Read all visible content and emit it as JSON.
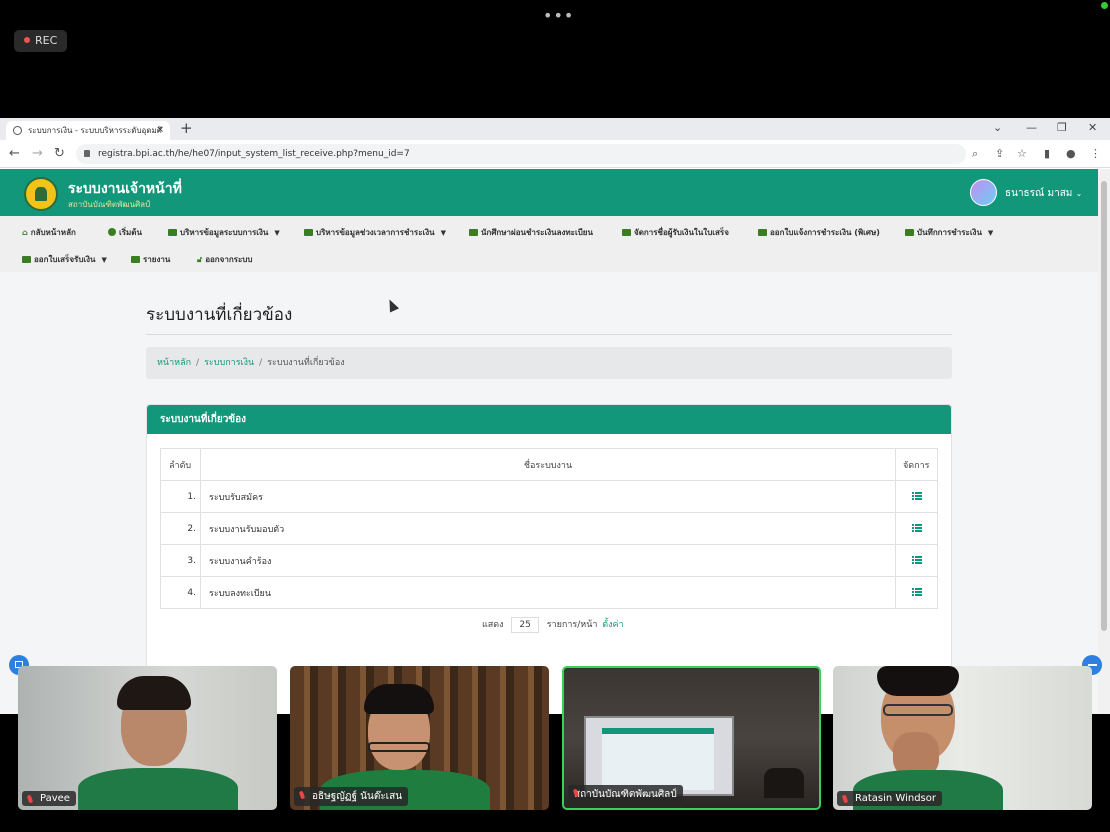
{
  "overlay": {
    "rec_label": "REC",
    "more_dots": "•••"
  },
  "browser": {
    "tab_title": "ระบบการเงิน - ระบบบริหารระดับอุดมศึ",
    "close_tab": "×",
    "new_tab": "+",
    "url": "registra.bpi.ac.th/he/he07/input_system_list_receive.php?menu_id=7"
  },
  "header": {
    "brand_title": "ระบบงานเจ้าหน้าที่",
    "brand_subtitle": "สถาบันบัณฑิตพัฒนศิลป์",
    "user_name": "ธนาธรณ์ มาสม"
  },
  "menu": {
    "items": [
      "กลับหน้าหลัก",
      "เริ่มต้น",
      "บริหารข้อมูลระบบการเงิน",
      "บริหารข้อมูลช่วงเวลาการชำระเงิน",
      "นักศึกษาผ่อนชำระเงินลงทะเบียน",
      "จัดการชื่อผู้รับเงินในใบเสร็จ",
      "ออกใบแจ้งการชำระเงิน (พิเศษ)",
      "บันทึกการชำระเงิน",
      "ออกใบเสร็จรับเงิน",
      "รายงาน",
      "ออกจากระบบ"
    ]
  },
  "main": {
    "page_title": "ระบบงานที่เกี่ยวข้อง",
    "breadcrumb": [
      "หน้าหลัก",
      "ระบบการเงิน",
      "ระบบงานที่เกี่ยวข้อง"
    ],
    "card_title": "ระบบงานที่เกี่ยวข้อง",
    "table": {
      "headers": [
        "ลำดับ",
        "ชื่อระบบงาน",
        "จัดการ"
      ],
      "rows": [
        {
          "no": "1.",
          "name": "ระบบรับสมัคร"
        },
        {
          "no": "2.",
          "name": "ระบบงานรับมอบตัว"
        },
        {
          "no": "3.",
          "name": "ระบบงานคำร้อง"
        },
        {
          "no": "4.",
          "name": "ระบบลงทะเบียน"
        }
      ]
    },
    "pager": {
      "show_label": "แสดง",
      "page_size": "25",
      "per_page_label": "รายการ/หน้า",
      "settings_link": "ตั้งค่า"
    }
  },
  "participants": [
    {
      "name": "Pavee"
    },
    {
      "name": "อธิษฐญัฏฐ์ นันต๊ะเสน"
    },
    {
      "name": "สถาบันบัณฑิตพัฒนศิลป์"
    },
    {
      "name": "Ratasin Windsor"
    }
  ],
  "colors": {
    "brand_green": "#12977a",
    "menu_icon_green": "#3a7d23",
    "active_speaker_border": "#3ccf5a"
  }
}
